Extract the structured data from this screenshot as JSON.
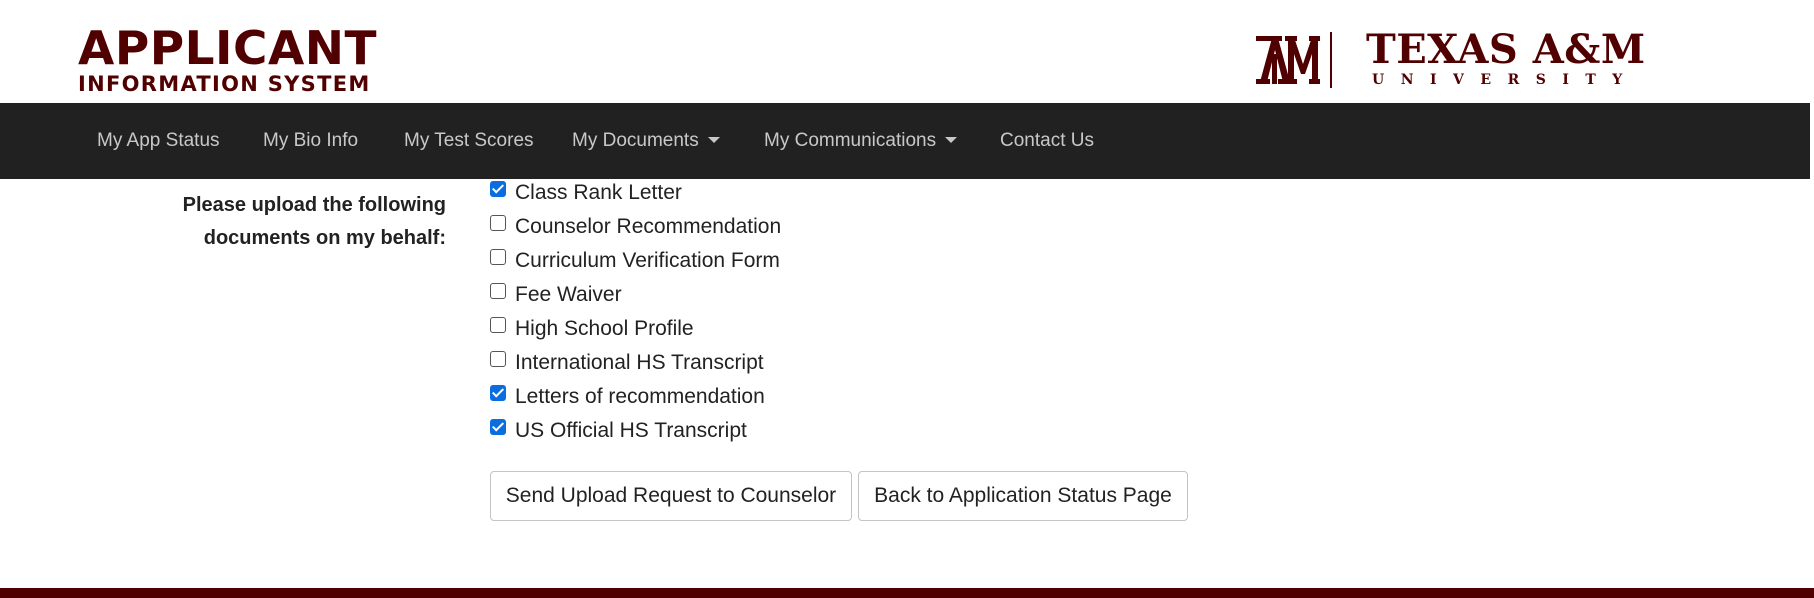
{
  "brand": {
    "line1": "APPLICANT",
    "line2": "INFORMATION SYSTEM"
  },
  "university_logo": {
    "name": "TEXAS A&M",
    "subtitle": "UNIVERSITY",
    "mark": "ATM"
  },
  "nav": {
    "items": [
      {
        "label": "My App Status"
      },
      {
        "label": "My Bio Info"
      },
      {
        "label": "My Test Scores"
      },
      {
        "label": "My Documents",
        "dropdown": true
      },
      {
        "label": "My Communications",
        "dropdown": true
      },
      {
        "label": "Contact Us"
      }
    ]
  },
  "form": {
    "label_line1": "Please upload the following",
    "label_line2": "documents on my behalf:",
    "documents": [
      {
        "label": "Class Rank Letter",
        "checked": true
      },
      {
        "label": "Counselor Recommendation",
        "checked": false
      },
      {
        "label": "Curriculum Verification Form",
        "checked": false
      },
      {
        "label": "Fee Waiver",
        "checked": false
      },
      {
        "label": "High School Profile",
        "checked": false
      },
      {
        "label": "International HS Transcript",
        "checked": false
      },
      {
        "label": "Letters of recommendation",
        "checked": true
      },
      {
        "label": "US Official HS Transcript",
        "checked": true
      }
    ],
    "send_button": "Send Upload Request to Counselor",
    "back_button": "Back to Application Status Page"
  },
  "colors": {
    "brand_maroon": "#500000",
    "nav_bg": "#212121",
    "checkbox_accent": "#0a6ee0"
  }
}
